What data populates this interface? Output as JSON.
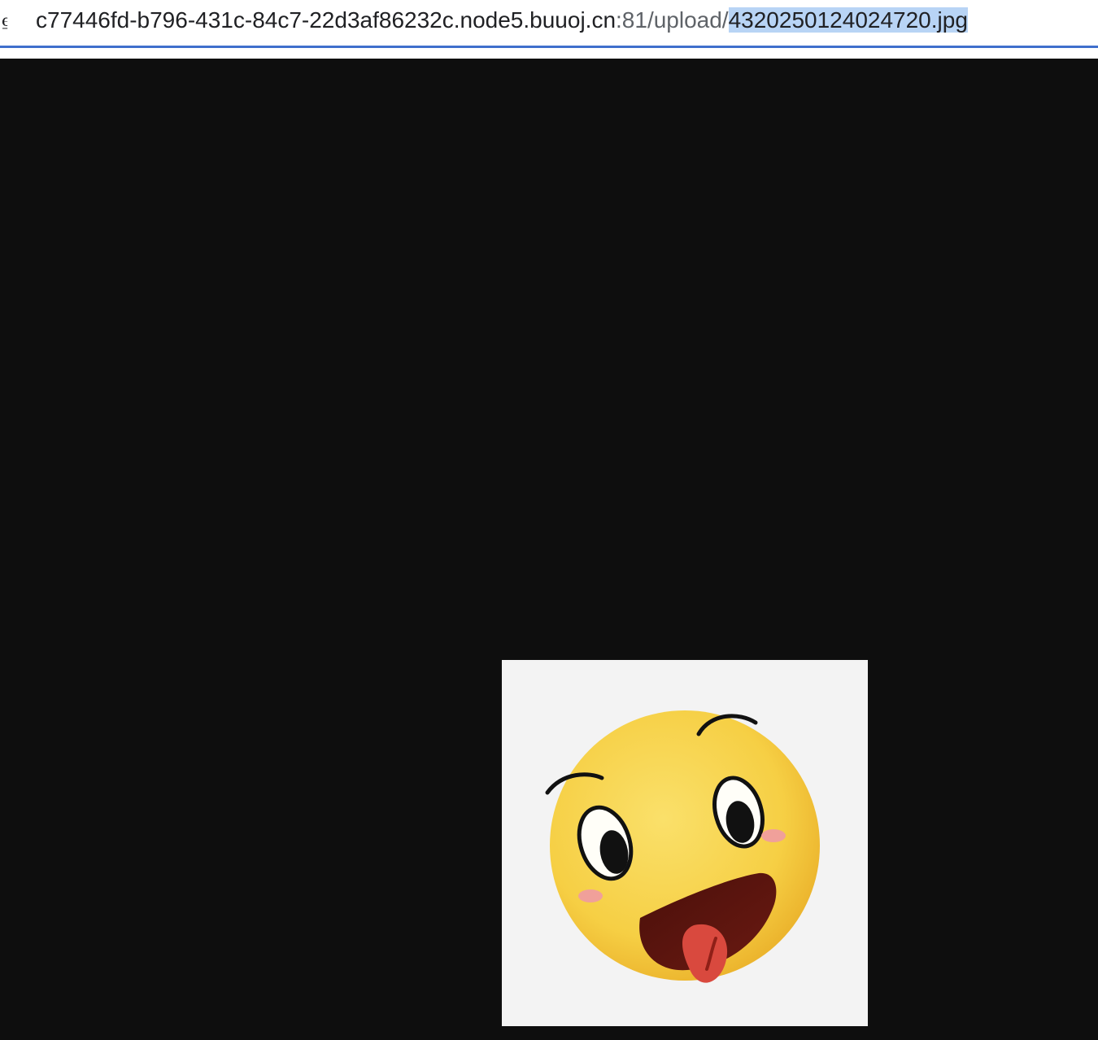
{
  "browser": {
    "security_icon": "lock-icon",
    "url": {
      "host": "c77446fd-b796-431c-84c7-22d3af86232c.node5.buuoj.cn",
      "rest": ":81/upload/",
      "selected": "4320250124024720.jpg"
    },
    "accent_color": "#3f6fcc",
    "selection_color": "#b8d4f5"
  },
  "viewport": {
    "background_color": "#0e0e0e",
    "image": {
      "subject": "tongue-out-emoji",
      "background_color": "#f3f3f3",
      "face_color": "#f7cf44"
    }
  }
}
